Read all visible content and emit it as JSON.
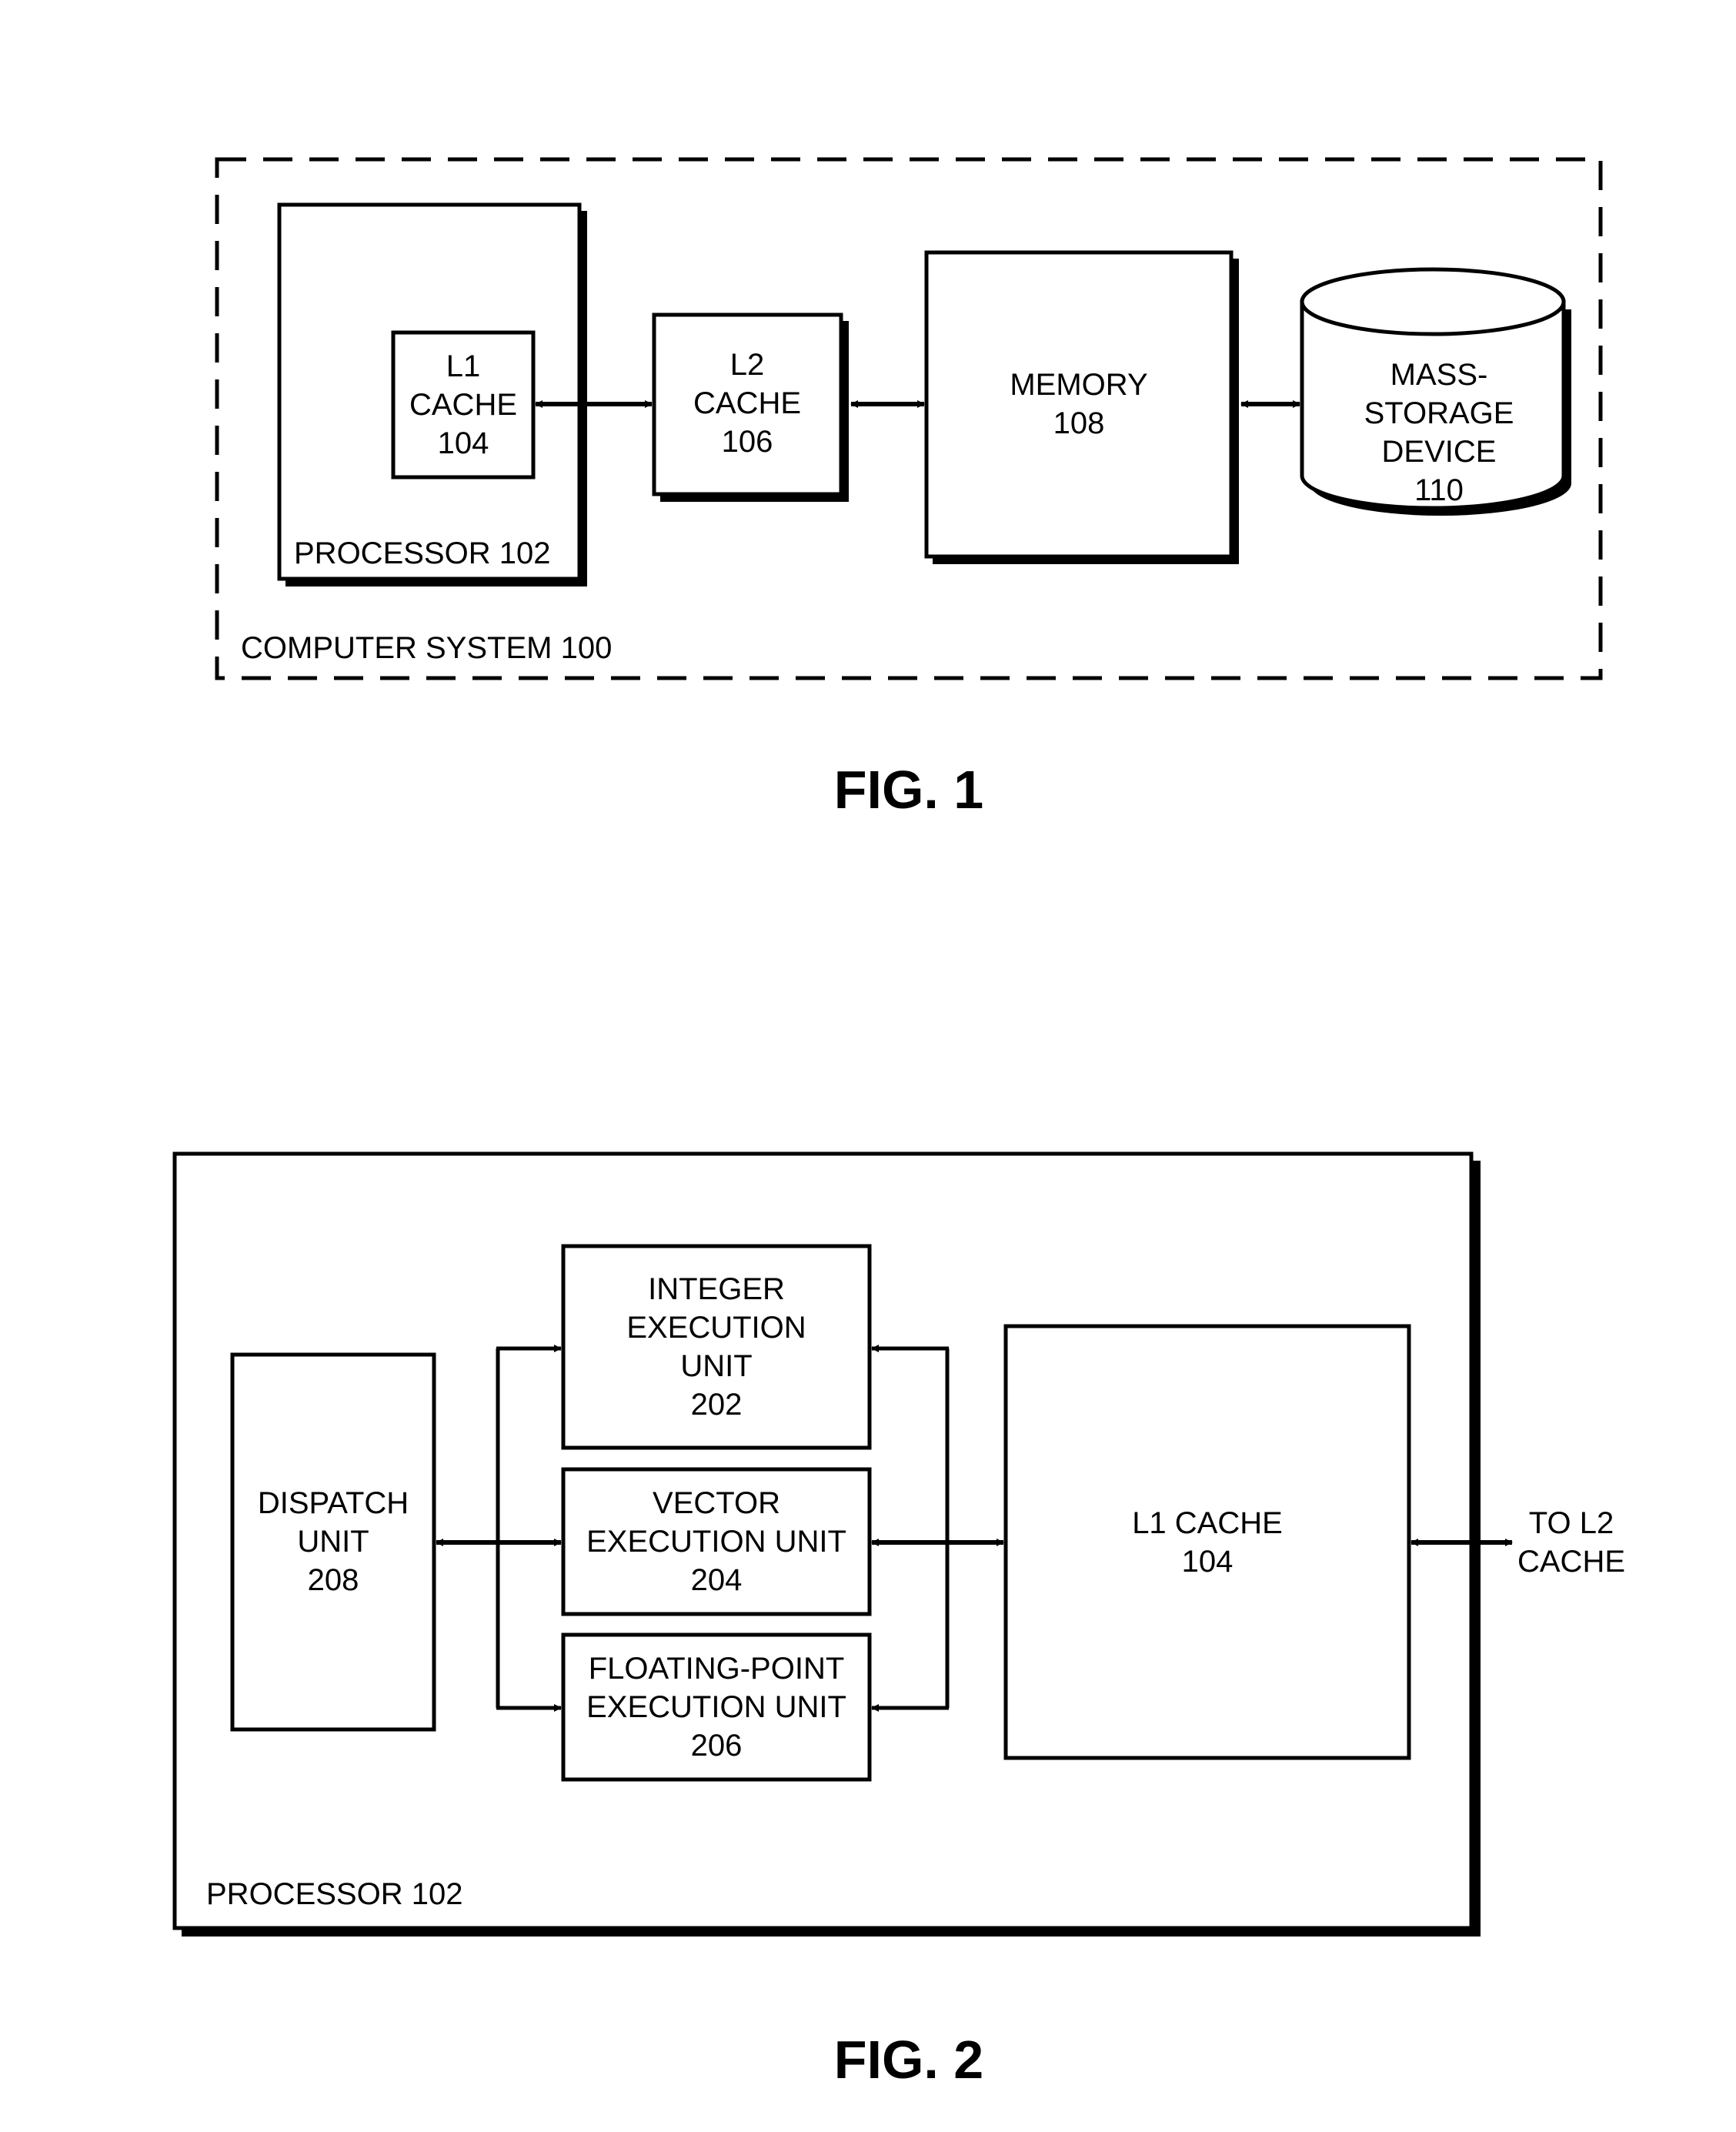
{
  "figure1": {
    "caption": "FIG. 1",
    "system_label": "COMPUTER SYSTEM 100",
    "processor_label": "PROCESSOR 102",
    "l1_cache": [
      "L1",
      "CACHE",
      "104"
    ],
    "l2_cache": [
      "L2",
      "CACHE",
      "106"
    ],
    "memory": [
      "MEMORY",
      "108"
    ],
    "mass_storage": [
      "MASS-",
      "STORAGE",
      "DEVICE",
      "110"
    ],
    "connections": [
      {
        "from": "L1 CACHE 104",
        "to": "L2 CACHE 106",
        "direction": "bidirectional"
      },
      {
        "from": "L2 CACHE 106",
        "to": "MEMORY 108",
        "direction": "bidirectional"
      },
      {
        "from": "MEMORY 108",
        "to": "MASS-STORAGE DEVICE 110",
        "direction": "bidirectional"
      }
    ]
  },
  "figure2": {
    "caption": "FIG. 2",
    "processor_label": "PROCESSOR 102",
    "dispatch_unit": [
      "DISPATCH",
      "UNIT",
      "208"
    ],
    "integer_unit": [
      "INTEGER",
      "EXECUTION",
      "UNIT",
      "202"
    ],
    "vector_unit": [
      "VECTOR",
      "EXECUTION UNIT",
      "204"
    ],
    "fp_unit": [
      "FLOATING-POINT",
      "EXECUTION UNIT",
      "206"
    ],
    "l1_cache": [
      "L1 CACHE",
      "104"
    ],
    "external": [
      "TO L2",
      "CACHE"
    ],
    "connections": [
      {
        "from": "DISPATCH UNIT 208",
        "to": "INTEGER EXECUTION UNIT 202",
        "direction": "to"
      },
      {
        "from": "DISPATCH UNIT 208",
        "to": "VECTOR EXECUTION UNIT 204",
        "direction": "bidirectional"
      },
      {
        "from": "DISPATCH UNIT 208",
        "to": "FLOATING-POINT EXECUTION UNIT 206",
        "direction": "to"
      },
      {
        "from": "L1 CACHE 104",
        "to": "INTEGER EXECUTION UNIT 202",
        "direction": "to"
      },
      {
        "from": "L1 CACHE 104",
        "to": "VECTOR EXECUTION UNIT 204",
        "direction": "bidirectional"
      },
      {
        "from": "L1 CACHE 104",
        "to": "FLOATING-POINT EXECUTION UNIT 206",
        "direction": "to"
      },
      {
        "from": "L1 CACHE 104",
        "to": "TO L2 CACHE",
        "direction": "bidirectional"
      }
    ]
  }
}
